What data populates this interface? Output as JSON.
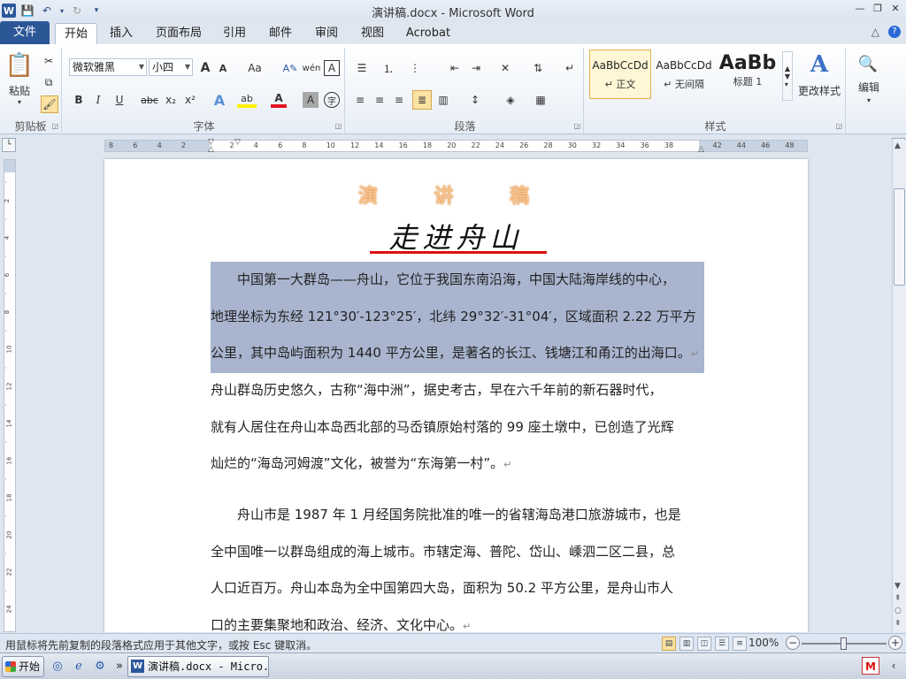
{
  "window": {
    "title": "演讲稿.docx - Microsoft Word",
    "app_logo": "W",
    "controls": [
      "—",
      "❐",
      "✕"
    ]
  },
  "tabs": [
    {
      "label": "文件",
      "kind": "file"
    },
    {
      "label": "开始",
      "active": true
    },
    {
      "label": "插入"
    },
    {
      "label": "页面布局"
    },
    {
      "label": "引用"
    },
    {
      "label": "邮件"
    },
    {
      "label": "审阅"
    },
    {
      "label": "视图"
    },
    {
      "label": "Acrobat"
    }
  ],
  "ribbon": {
    "clipboard": {
      "label": "剪贴板",
      "paste": "粘贴"
    },
    "font": {
      "label": "字体",
      "font_name": "微软雅黑",
      "font_size": "小四",
      "grow": "A",
      "shrink": "A",
      "case": "Aa",
      "bold": "B",
      "italic": "I",
      "underline": "U",
      "strike": "abc",
      "sub": "x₂",
      "sup": "x²",
      "text_effect": "A",
      "highlight": "ab",
      "font_color": "A",
      "char_shading": "A",
      "enclose": "字",
      "phonetic": "wén",
      "border": "A"
    },
    "paragraph": {
      "label": "段落"
    },
    "styles": {
      "label": "样式",
      "items": [
        {
          "sample": "AaBbCcDd",
          "name": "↵ 正文",
          "selected": true
        },
        {
          "sample": "AaBbCcDd",
          "name": "↵ 无间隔"
        },
        {
          "sample": "AaBb",
          "name": "标题 1"
        }
      ],
      "change_styles": "更改样式"
    },
    "editing": {
      "label": "编辑"
    }
  },
  "ruler": {
    "ticks": [
      "8",
      "6",
      "4",
      "2",
      "",
      "2",
      "4",
      "6",
      "8",
      "10",
      "12",
      "14",
      "16",
      "18",
      "20",
      "22",
      "24",
      "26",
      "28",
      "30",
      "32",
      "34",
      "36",
      "38",
      "",
      "42",
      "44",
      "46",
      "48"
    ]
  },
  "document": {
    "title1": "演 讲 稿",
    "title2": "走进舟山",
    "para1": [
      "　　中国第一大群岛——舟山，它位于我国东南沿海，中国大陆海岸线的中心，",
      "地理坐标为东经 121°30′-123°25′，北纬 29°32′-31°04′，区域面积 2.22 万平方",
      "公里，其中岛屿面积为 1440 平方公里，是著名的长江、钱塘江和甬江的出海口。"
    ],
    "para2": [
      "舟山群岛历史悠久，古称“海中洲”，据史考古，早在六千年前的新石器时代，",
      "就有人居住在舟山本岛西北部的马岙镇原始村落的 99 座土墩中，已创造了光辉",
      "灿烂的“海岛河姆渡”文化，被誉为“东海第一村”。"
    ],
    "para3": [
      "　　舟山市是 1987 年 1 月经国务院批准的唯一的省辖海岛港口旅游城市，也是",
      "全中国唯一以群岛组成的海上城市。市辖定海、普陀、岱山、嵊泗二区二县，总",
      "人口近百万。舟山本岛为全中国第四大岛，面积为 50.2 平方公里，是舟山市人",
      "口的主要集聚地和政治、经济、文化中心。"
    ],
    "para_mark": "↵"
  },
  "status": {
    "message": "用鼠标将先前复制的段落格式应用于其他文字，或按 Esc 键取消。",
    "zoom": "100%"
  },
  "taskbar": {
    "start": "开始",
    "word_task": "演讲稿.docx - Micro...",
    "overflow": "»",
    "tray_logo": "M"
  }
}
